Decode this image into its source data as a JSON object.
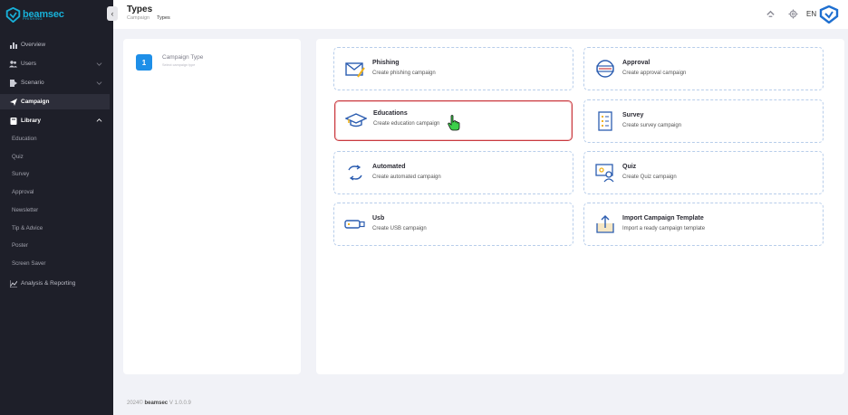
{
  "app": {
    "logo_text": "beamsec",
    "logo_sub": "PHISHING",
    "collapse_glyph": "‹"
  },
  "sidebar": {
    "items": [
      {
        "label": "Overview",
        "icon": "bar-chart-icon"
      },
      {
        "label": "Users",
        "icon": "users-icon",
        "chevron": "down"
      },
      {
        "label": "Scenario",
        "icon": "scenario-icon",
        "chevron": "down"
      },
      {
        "label": "Campaign",
        "icon": "send-icon",
        "active": true
      },
      {
        "label": "Library",
        "icon": "book-icon",
        "chevron": "up"
      }
    ],
    "library_sub": [
      "Education",
      "Quiz",
      "Survey",
      "Approval",
      "Newsletter",
      "Tip & Advice",
      "Poster",
      "Screen Saver"
    ],
    "analysis": {
      "label": "Analysis & Reporting",
      "icon": "line-chart-icon"
    }
  },
  "header": {
    "title": "Types",
    "breadcrumb": [
      "Campaign",
      "Types"
    ],
    "lang": "EN"
  },
  "steps": [
    {
      "number": "1",
      "title": "Campaign Type",
      "subtitle": "Select campaign type"
    }
  ],
  "cards": [
    {
      "title": "Phishing",
      "desc": "Create phishing campaign",
      "icon": "phishing-mail-icon"
    },
    {
      "title": "Approval",
      "desc": "Create approval campaign",
      "icon": "approval-icon"
    },
    {
      "title": "Educations",
      "desc": "Create education campaign",
      "icon": "graduation-cap-icon",
      "selected": true
    },
    {
      "title": "Survey",
      "desc": "Create survey campaign",
      "icon": "survey-list-icon"
    },
    {
      "title": "Automated",
      "desc": "Create automated campaign",
      "icon": "automated-cycle-icon"
    },
    {
      "title": "Quiz",
      "desc": "Create Quiz campaign",
      "icon": "quiz-presenter-icon"
    },
    {
      "title": "Usb",
      "desc": "Create USB campaign",
      "icon": "usb-icon"
    },
    {
      "title": "Import Campaign Template",
      "desc": "Import a ready campaign template",
      "icon": "import-upload-icon"
    }
  ],
  "footer": {
    "year": "2024©",
    "brand": "beamsec",
    "version": "V 1.0.0.9"
  },
  "colors": {
    "sidebar_bg": "#1e1f29",
    "accent_blue": "#1e8fe8",
    "selected_border": "#c83a3f",
    "card_border": "#b7cdea"
  }
}
